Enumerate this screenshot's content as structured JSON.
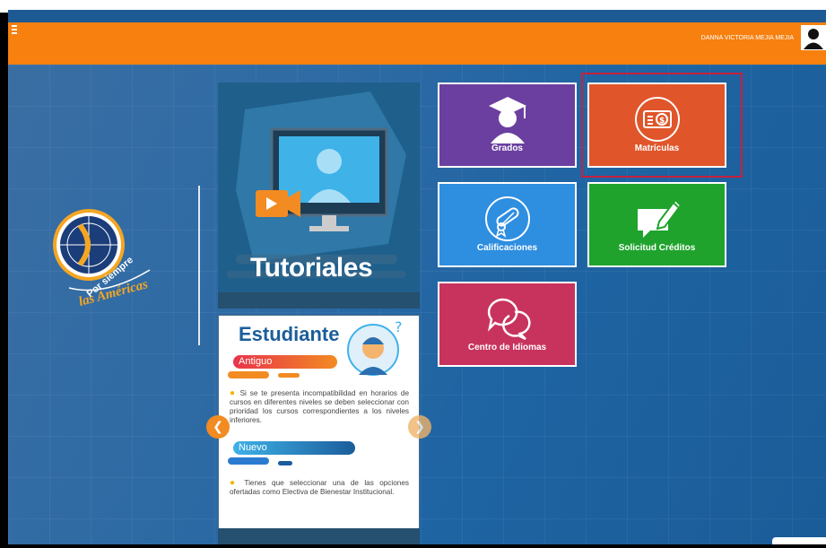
{
  "header": {
    "user_name": "DANNA VICTORIA MEJIA MEJIA"
  },
  "logo": {
    "text_line1": "Por siempre",
    "text_line2": "las Américas"
  },
  "tutorials": {
    "title": "Tutoriales"
  },
  "student_card": {
    "title": "Estudiante",
    "section1_label": "Antiguo",
    "section1_text": "Si se te presenta incompatibilidad en horarios de cursos en diferentes niveles se deben seleccionar con prioridad los cursos correspondientes a los niveles inferiores.",
    "section2_label": "Nuevo",
    "section2_text": "Tienes que seleccionar una de las opciones ofertadas como Electiva de Bienestar Institucional."
  },
  "tiles": [
    {
      "label": "Grados",
      "color": "#6b3fa0"
    },
    {
      "label": "Matrículas",
      "color": "#e0552a"
    },
    {
      "label": "Calificaciones",
      "color": "#2e8ee0"
    },
    {
      "label": "Solicitud Créditos",
      "color": "#1fa32d"
    },
    {
      "label": "Centro de Idiomas",
      "color": "#c8335e"
    }
  ],
  "colors": {
    "topbar": "#f7800f",
    "highlight": "#c8203d"
  }
}
